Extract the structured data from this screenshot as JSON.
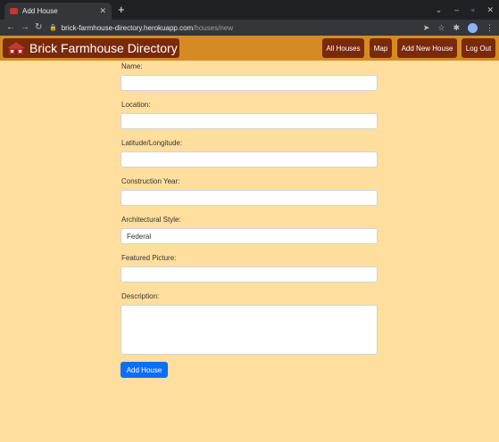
{
  "browser": {
    "tab_title": "Add House",
    "new_tab_label": "+",
    "url_host": "brick-farmhouse-directory.herokuapp.com",
    "url_path": "/houses/new"
  },
  "navbar": {
    "brand": "Brick Farmhouse Directory",
    "links": [
      "All Houses",
      "Map",
      "Add New House",
      "Log Out"
    ]
  },
  "form": {
    "fields": [
      {
        "label": "Name:",
        "value": ""
      },
      {
        "label": "Location:",
        "value": ""
      },
      {
        "label": "Latitude/Longitude:",
        "value": ""
      },
      {
        "label": "Construction Year:",
        "value": ""
      },
      {
        "label": "Architectural Style:",
        "value": "Federal"
      },
      {
        "label": "Featured Picture:",
        "value": ""
      }
    ],
    "description_label": "Description:",
    "submit_label": "Add House"
  }
}
